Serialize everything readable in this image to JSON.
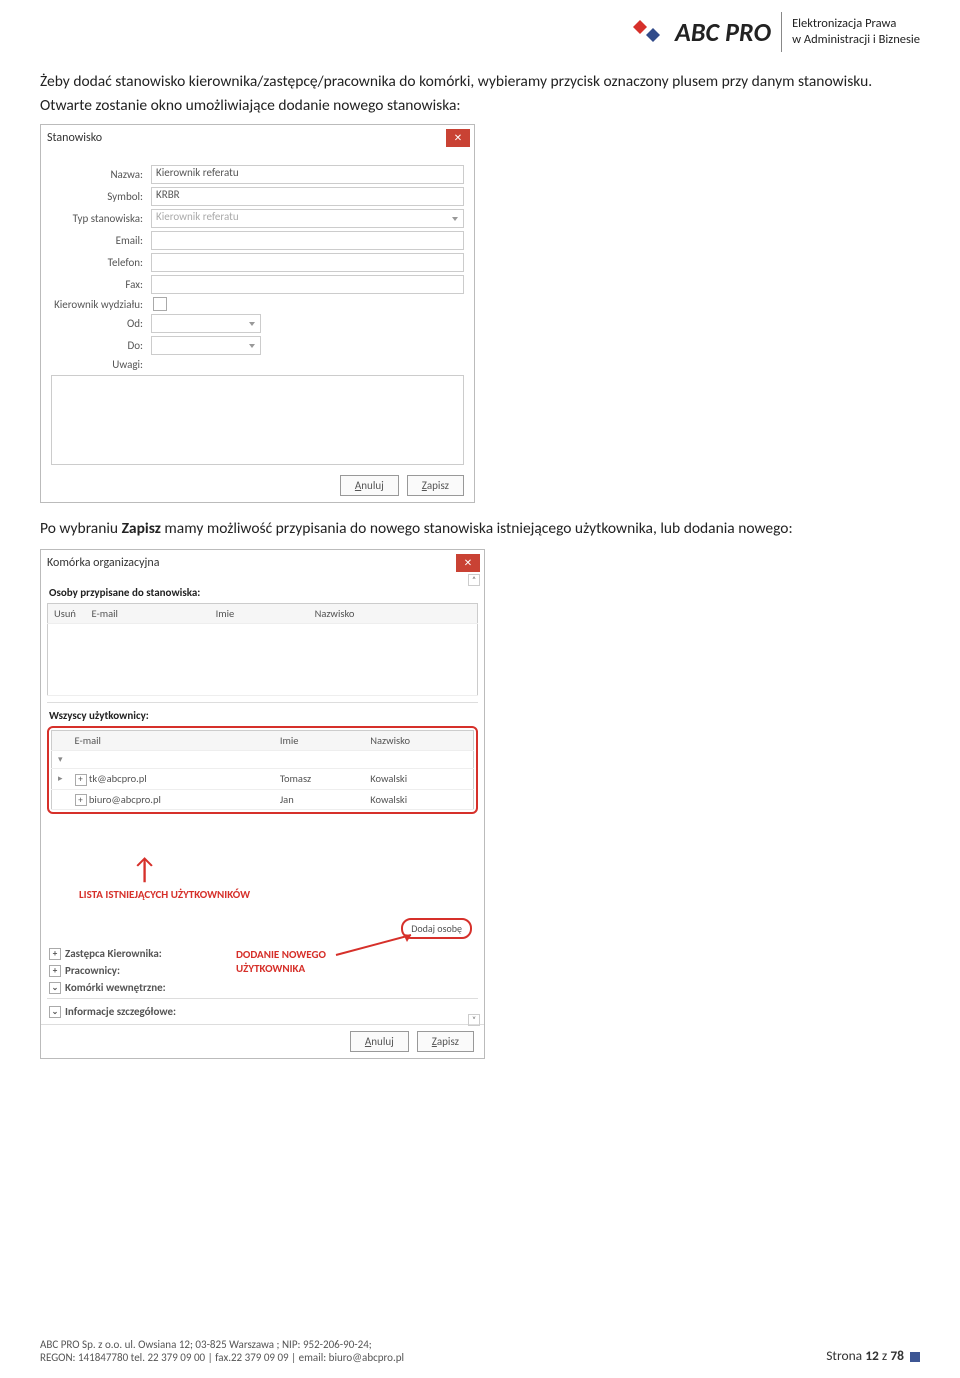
{
  "brand": {
    "name": "ABC PRO",
    "tag_line1": "Elektronizacja Prawa",
    "tag_line2": "w Administracji i Biznesie"
  },
  "para1": "Żeby dodać stanowisko kierownika/zastępcę/pracownika do komórki, wybieramy przycisk oznaczony plusem przy danym stanowisku. Otwarte zostanie okno umożliwiające dodanie nowego stanowiska:",
  "dialog1": {
    "title": "Stanowisko",
    "labels": {
      "nazwa": "Nazwa:",
      "symbol": "Symbol:",
      "typ": "Typ stanowiska:",
      "email": "Email:",
      "telefon": "Telefon:",
      "fax": "Fax:",
      "kierownik": "Kierownik wydziału:",
      "od": "Od:",
      "do": "Do:",
      "uwagi": "Uwagi:"
    },
    "values": {
      "nazwa": "Kierownik referatu",
      "symbol": "KRBR",
      "typ": "Kierownik referatu"
    },
    "buttons": {
      "anuluj": "Anuluj",
      "zapisz": "Zapisz"
    }
  },
  "para2_pre": "Po wybraniu ",
  "para2_bold": "Zapisz",
  "para2_post": " mamy możliwość przypisania do nowego stanowiska istniejącego użytkownika, lub dodania nowego:",
  "dialog2": {
    "title": "Komórka organizacyjna",
    "sec1": "Osoby przypisane do stanowiska:",
    "tbl1_head": {
      "c1": "Usuń",
      "c2": "E-mail",
      "c3": "Imie",
      "c4": "Nazwisko"
    },
    "sec2": "Wszyscy użytkownicy:",
    "tbl2_head": {
      "c1": "",
      "c2": "E-mail",
      "c3": "Imie",
      "c4": "Nazwisko"
    },
    "rows": [
      {
        "email": "tk@abcpro.pl",
        "imie": "Tomasz",
        "nazw": "Kowalski"
      },
      {
        "email": "biuro@abcpro.pl",
        "imie": "Jan",
        "nazw": "Kowalski"
      }
    ],
    "red_label1": "LISTA ISTNIEJĄCYCH UŻYTKOWNIKÓW",
    "red_label2a": "DODANIE NOWEGO",
    "red_label2b": "UŻYTKOWNIKA",
    "add_person": "Dodaj osobę",
    "mini": {
      "zast": "Zastępca Kierownika:",
      "prac": "Pracownicy:",
      "kom": "Komórki wewnętrzne:",
      "info": "Informacje szczegółowe:"
    },
    "buttons": {
      "anuluj": "Anuluj",
      "zapisz": "Zapisz"
    }
  },
  "footer": {
    "line1": "ABC PRO Sp. z o.o. ul. Owsiana 12;  03-825 Warszawa ; NIP: 952-206-90-24;",
    "line2": "REGON: 141847780 tel. 22 379 09 00 | fax.22 379 09 09 | email: biuro@abcpro.pl",
    "page_pre": "Strona ",
    "page_n": "12",
    "page_mid": " z ",
    "page_total": "78"
  }
}
